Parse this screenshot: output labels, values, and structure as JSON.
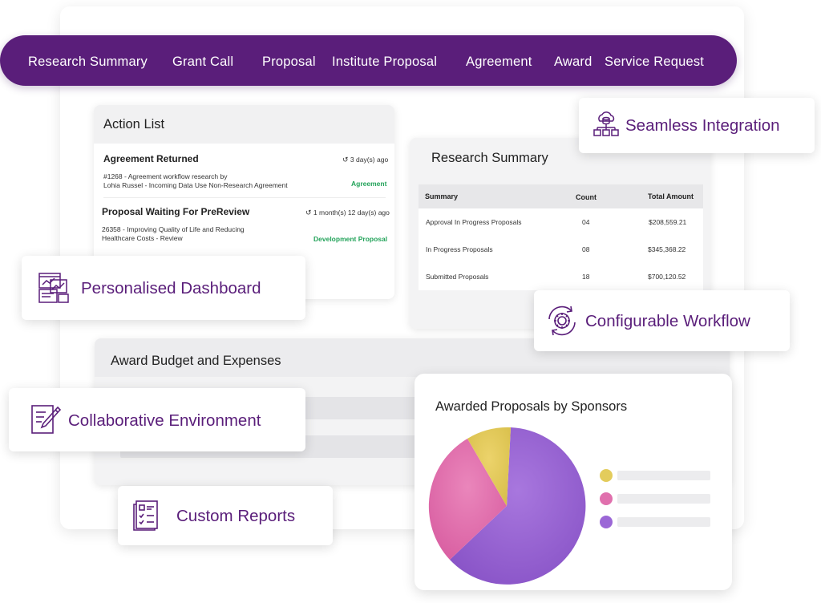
{
  "nav": {
    "items": [
      {
        "label": "Research Summary"
      },
      {
        "label": "Grant Call"
      },
      {
        "label": "Proposal"
      },
      {
        "label": "Institute Proposal"
      },
      {
        "label": "Agreement"
      },
      {
        "label": "Award"
      },
      {
        "label": "Service Request"
      }
    ]
  },
  "action_list": {
    "title": "Action List",
    "items": [
      {
        "title": "Agreement Returned",
        "time": "3 day(s) ago",
        "line1": "#1268 - Agreement workflow research by",
        "line2": "Lohia Russel  - Incoming Data Use Non-Research Agreement",
        "tag": "Agreement"
      },
      {
        "title": "Proposal Waiting For PreReview",
        "time": "1 month(s) 12 day(s) ago",
        "line1": "26358 - Improving Quality of Life and Reducing",
        "line2": "Healthcare Costs -  Review",
        "tag": "Development Proposal"
      }
    ]
  },
  "research_summary": {
    "title": "Research Summary",
    "columns": [
      "Summary",
      "Count",
      "Total Amount"
    ],
    "rows": [
      {
        "summary": "Approval In Progress Proposals",
        "count": "04",
        "amount": "$208,559.21"
      },
      {
        "summary": "In Progress Proposals",
        "count": "08",
        "amount": "$345,368.22"
      },
      {
        "summary": "Submitted Proposals",
        "count": "18",
        "amount": "$700,120.52"
      }
    ]
  },
  "award_budget": {
    "title": "Award Budget and Expenses"
  },
  "pie_card": {
    "title": "Awarded Proposals by Sponsors",
    "colors": {
      "purple": "#9b67d6",
      "pink": "#e070ad",
      "yellow": "#e3cc5c"
    }
  },
  "features": {
    "seamless": "Seamless Integration",
    "personalised": "Personalised Dashboard",
    "configurable": "Configurable Workflow",
    "collaborative": "Collaborative Environment",
    "reports": "Custom Reports"
  },
  "colors": {
    "brand_purple": "#5a1e7a",
    "tag_green": "#23a35a"
  }
}
